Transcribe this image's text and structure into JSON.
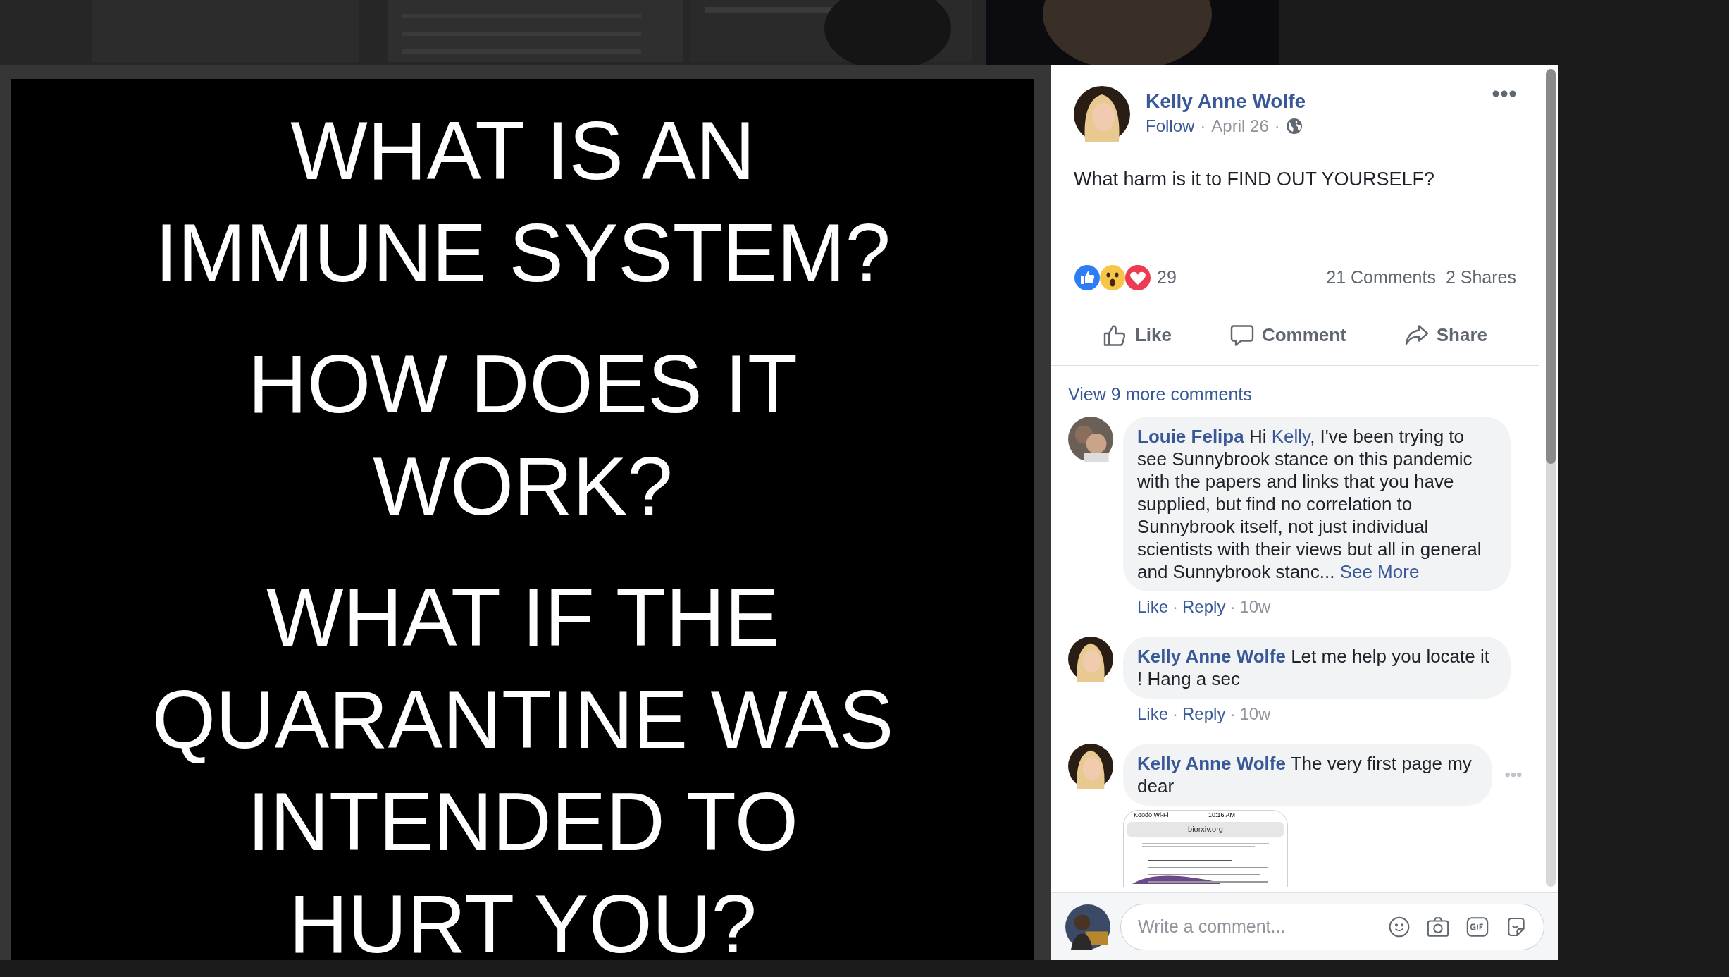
{
  "photo": {
    "groups": [
      {
        "lines": [
          "WHAT IS AN",
          "IMMUNE SYSTEM?"
        ]
      },
      {
        "lines": [
          "HOW DOES IT",
          "WORK?"
        ]
      },
      {
        "lines": [
          "WHAT IF THE",
          "QUARANTINE WAS",
          "INTENDED TO",
          "HURT YOU?"
        ]
      }
    ]
  },
  "post": {
    "author": "Kelly Anne Wolfe",
    "follow": "Follow",
    "separator": "·",
    "date": "April 26",
    "text": "What harm is it to FIND OUT YOURSELF?",
    "reactions": [
      {
        "kind": "like"
      },
      {
        "kind": "wow"
      },
      {
        "kind": "love"
      }
    ],
    "reaction_count": "29",
    "comments_count": "21 Comments",
    "shares_count": "2 Shares",
    "actions": [
      {
        "kind": "like",
        "label": "Like"
      },
      {
        "kind": "comment",
        "label": "Comment"
      },
      {
        "kind": "share",
        "label": "Share"
      }
    ]
  },
  "view_more": "View 9 more comments",
  "comments": [
    {
      "author": "Louie Felipa",
      "parts": [
        {
          "text": " Hi ",
          "link": false
        },
        {
          "text": "Kelly",
          "link": true
        },
        {
          "text": ", I've been trying to see Sunnybrook stance on this pandemic with the papers and links that you have supplied, but find no correlation to Sunnybrook itself, not just individual scientists with their views but all in general and Sunnybrook stanc... ",
          "link": false
        },
        {
          "text": "See More",
          "link": true
        }
      ],
      "like": "Like",
      "separator": "·",
      "reply": "Reply",
      "separator_2": "·",
      "time": "10w"
    },
    {
      "author": "Kelly Anne Wolfe",
      "parts": [
        {
          "text": " Let me help you locate it ! Hang a sec",
          "link": false
        }
      ],
      "like": "Like",
      "separator": "·",
      "reply": "Reply",
      "separator_2": "·",
      "time": "10w"
    },
    {
      "author": "Kelly Anne Wolfe",
      "parts": [
        {
          "text": " The very first page my dear",
          "link": false
        }
      ],
      "options": true,
      "attachment": {
        "carrier": "Koodo Wi-Fi",
        "clock": "10:16 AM",
        "url": "biorxiv.org"
      }
    }
  ],
  "composer": {
    "placeholder": "Write a comment..."
  }
}
